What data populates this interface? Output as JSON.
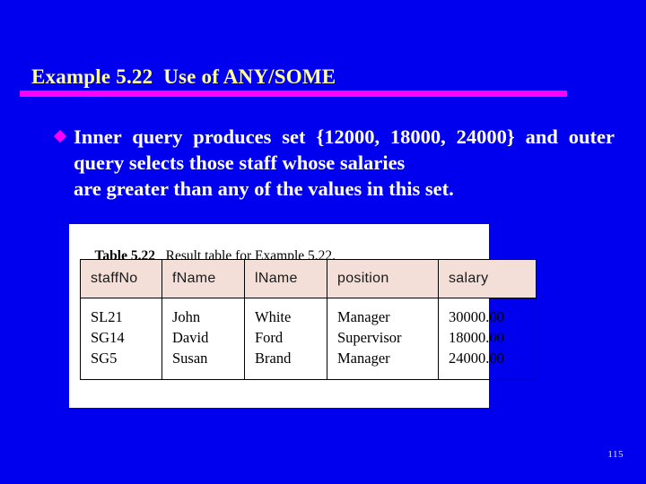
{
  "slide": {
    "title": "Example 5.22  Use of ANY/SOME",
    "page_number": "115",
    "colors": {
      "background": "#0000ee",
      "title_text": "#ffff99",
      "title_rule": "#ff00ff",
      "bullet_marker": "#ff00ff",
      "body_text": "#ffffff",
      "table_header_fill": "#f3ded8",
      "table_border": "#000000",
      "panel_fill": "#ffffff"
    }
  },
  "bullet": {
    "marker_icon": "diamond-bullet-icon",
    "line1": "Inner query produces set {12000, 18000, 24000}",
    "line2": "and outer query selects those staff whose salaries",
    "line3": "are greater than any of the values in this set."
  },
  "table": {
    "caption_label": "Table 5.22",
    "caption_text": "   Result table for Example 5.22.",
    "columns": [
      "staffNo",
      "fName",
      "lName",
      "position",
      "salary"
    ],
    "rows": [
      [
        "SL21",
        "John",
        "White",
        "Manager",
        "30000.00"
      ],
      [
        "SG14",
        "David",
        "Ford",
        "Supervisor",
        "18000.00"
      ],
      [
        "SG5",
        "Susan",
        "Brand",
        "Manager",
        "24000.00"
      ]
    ],
    "cells": {
      "staffno": "SL21\nSG14\nSG5",
      "fname": "John\nDavid\nSusan",
      "lname": "White\nFord\nBrand",
      "position": "Manager\nSupervisor\nManager",
      "salary": "30000.00\n18000.00\n24000.00"
    }
  }
}
